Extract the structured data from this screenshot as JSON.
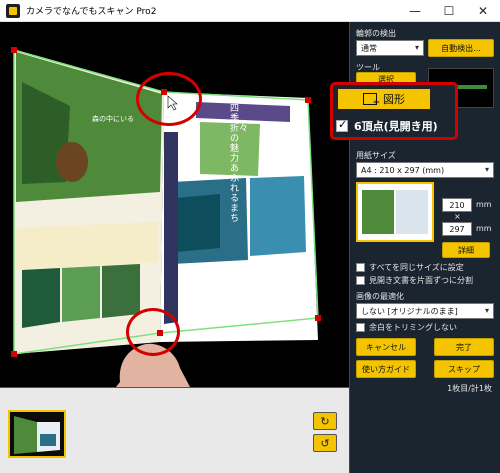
{
  "window": {
    "title": "カメラでなんでもスキャン Pro2",
    "minimize": "—",
    "maximize": "☐",
    "close": "✕"
  },
  "panel": {
    "edge_detect_label": "輪郭の検出",
    "edge_detect_value": "通常",
    "auto_detect_button": "自動検出...",
    "tools_label": "ツール",
    "select_label": "選択",
    "shape_button": "図形",
    "six_vertex_label": "6頂点(見開き用)",
    "paper_size_label": "用紙サイズ",
    "paper_size_value": "A4 : 210 x 297 (mm)",
    "width_value": "210",
    "height_value": "297",
    "unit": "mm",
    "times": "×",
    "detail_button": "詳細",
    "same_size_label": "すべてを同じサイズに設定",
    "split_label": "見開き文書を片面ずつに分割",
    "optimize_label": "画像の最適化",
    "optimize_value": "しない [オリジナルのまま]",
    "trim_label": "余白をトリミングしない",
    "cancel_button": "キャンセル",
    "done_button": "完了",
    "guide_button": "使い方ガイド",
    "skip_button": "スキップ",
    "page_count": "1枚目/計1枚"
  },
  "book": {
    "left_title": "森の中にいる",
    "right_title": "四季折々の魅力あふれるまち"
  },
  "colors": {
    "accent": "#f4c400",
    "panel_bg": "#1b2530",
    "highlight_red": "#d40000",
    "crop_line": "#7de07d"
  }
}
